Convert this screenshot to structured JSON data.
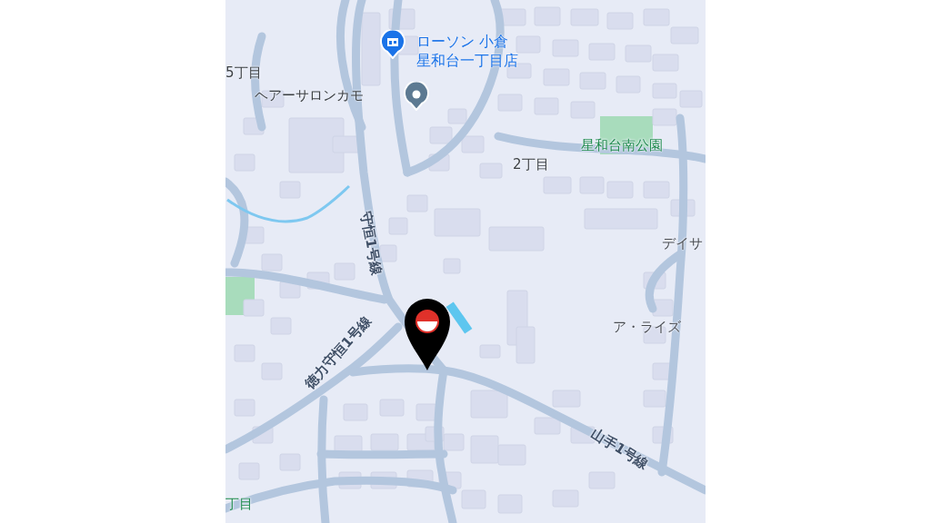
{
  "map": {
    "labels": [
      {
        "kind": "store",
        "lines": [
          "ローソン 小倉",
          "星和台一丁目店"
        ]
      },
      {
        "kind": "district",
        "text": "5丁目"
      },
      {
        "kind": "salon",
        "lines": [
          "ヘアーサロンカモ"
        ]
      },
      {
        "kind": "park",
        "text": "星和台南公園"
      },
      {
        "kind": "district",
        "text": "2丁目"
      },
      {
        "kind": "road",
        "text": "守恒1号線"
      },
      {
        "kind": "poi",
        "text": "デイサ"
      },
      {
        "kind": "poi",
        "text": "ア・ライズ"
      },
      {
        "kind": "road",
        "text": "徳力守恒1号線"
      },
      {
        "kind": "road",
        "text": "山手1号線"
      },
      {
        "kind": "park",
        "text": "丁目"
      }
    ]
  }
}
